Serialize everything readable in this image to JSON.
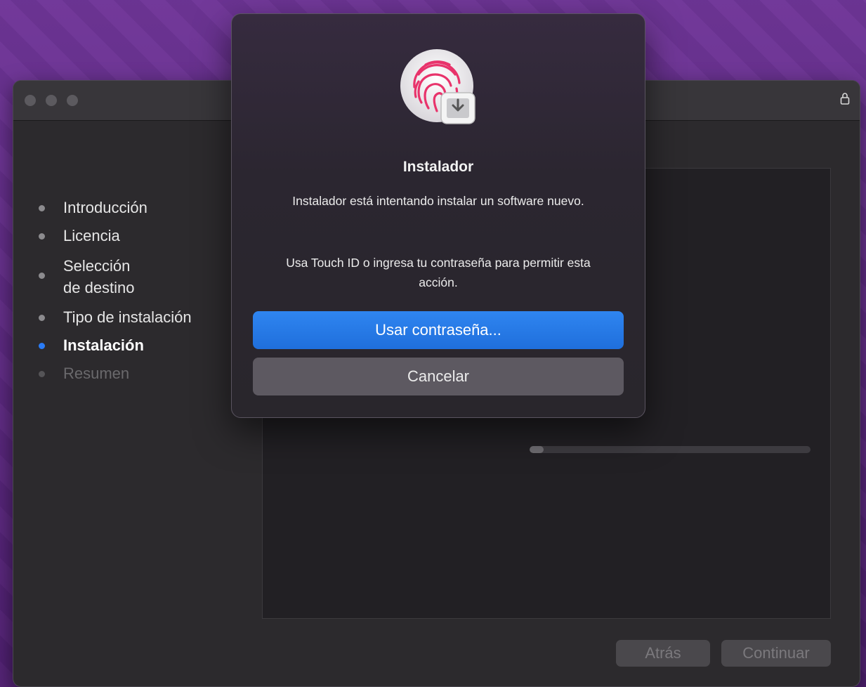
{
  "installer": {
    "steps": [
      {
        "label": "Introducción",
        "state": "done"
      },
      {
        "label": "Licencia",
        "state": "done"
      },
      {
        "label": "Selección",
        "label2": "de destino",
        "state": "done"
      },
      {
        "label": "Tipo de instalación",
        "state": "done"
      },
      {
        "label": "Instalación",
        "state": "active"
      },
      {
        "label": "Resumen",
        "state": "pending"
      }
    ],
    "progress_fraction": 0.05,
    "back_label": "Atrás",
    "continue_label": "Continuar"
  },
  "dialog": {
    "title": "Instalador",
    "message_line1": "Instalador está intentando instalar un software nuevo.",
    "message_line2": "Usa Touch ID o ingresa tu contraseña para permitir esta acción.",
    "primary_label": "Usar contraseña...",
    "cancel_label": "Cancelar",
    "icon": "touch-id-fingerprint-icon"
  },
  "colors": {
    "accent": "#2a7cf6",
    "primary_button": "#2378e6",
    "wallpaper": "#5a2a7c"
  }
}
